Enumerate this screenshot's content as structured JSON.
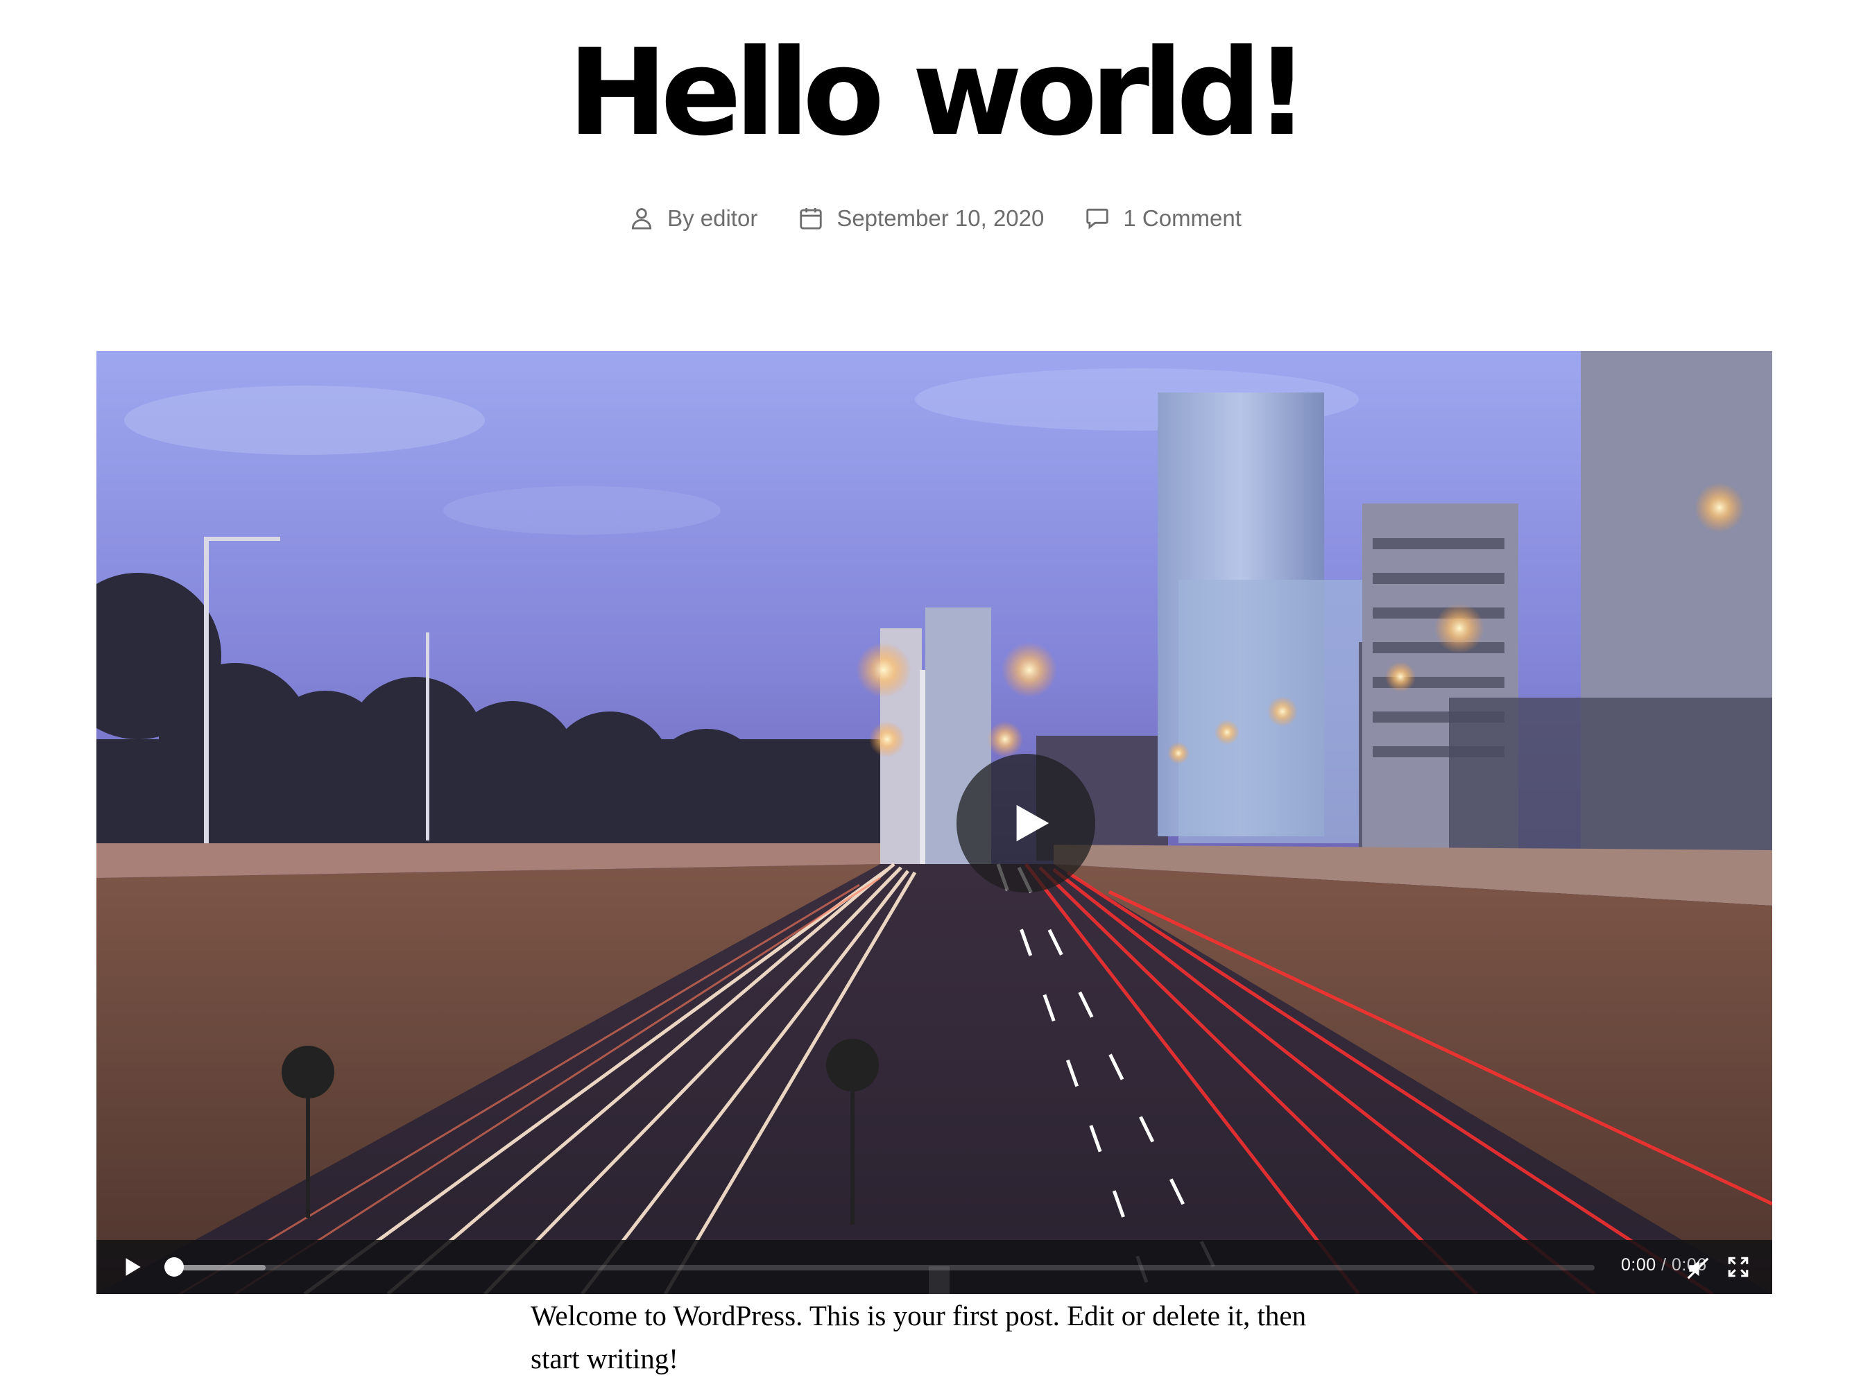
{
  "post": {
    "title": "Hello world!",
    "meta": {
      "author": "By editor",
      "date": "September 10, 2020",
      "comments": "1 Comment"
    },
    "content": "Welcome to WordPress. This is your first post. Edit or delete it, then start writing!"
  },
  "video": {
    "current_time": "0:00",
    "separator": "/",
    "duration": "0:06",
    "progress_fraction": 0,
    "buffered_fraction": 0.07
  },
  "icons": {
    "author": "person-icon",
    "date": "calendar-icon",
    "comments": "speech-bubble-icon",
    "play": "play-icon",
    "mute": "muted-speaker-icon",
    "fullscreen": "fullscreen-icon"
  }
}
